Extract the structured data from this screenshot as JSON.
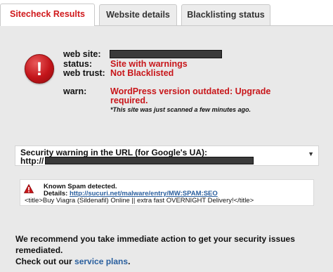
{
  "tabs": [
    {
      "label": "Sitecheck Results",
      "active": true
    },
    {
      "label": "Website details",
      "active": false
    },
    {
      "label": "Blacklisting status",
      "active": false
    }
  ],
  "result": {
    "alert_symbol": "!",
    "website_label": "web site:",
    "status_label": "status:",
    "status_value": "Site with warnings",
    "trust_label": "web trust:",
    "trust_value": "Not Blacklisted",
    "warn_label": "warn:",
    "warn_value_line1": "WordPress version outdated: Upgrade",
    "warn_value_line2": "required.",
    "scan_note": "*This site was just scanned a few minutes ago."
  },
  "security_warning": {
    "line1": "Security warning in the URL (for Google's UA):",
    "line2": "http://",
    "dropdown_icon": "chevron-down-icon"
  },
  "spam": {
    "icon": "warning-triangle-icon",
    "title": "Known Spam detected.",
    "details_label": "Details:",
    "details_link": "http://sucuri.net/malware/entry/MW:SPAM:SEO",
    "snippet": "<title>Buy Viagra (Sildenafil) Online || extra fast OVERNIGHT Delivery!</title>"
  },
  "recommendation": {
    "line1": "We recommend you take immediate action to get your security issues remediated.",
    "line2_prefix": "Check out our",
    "link_text": "service plans",
    "line2_suffix": "."
  },
  "colors": {
    "alert_red": "#c8161a",
    "link_blue": "#2a5f9e",
    "panel_bg": "#e9e9e9"
  }
}
